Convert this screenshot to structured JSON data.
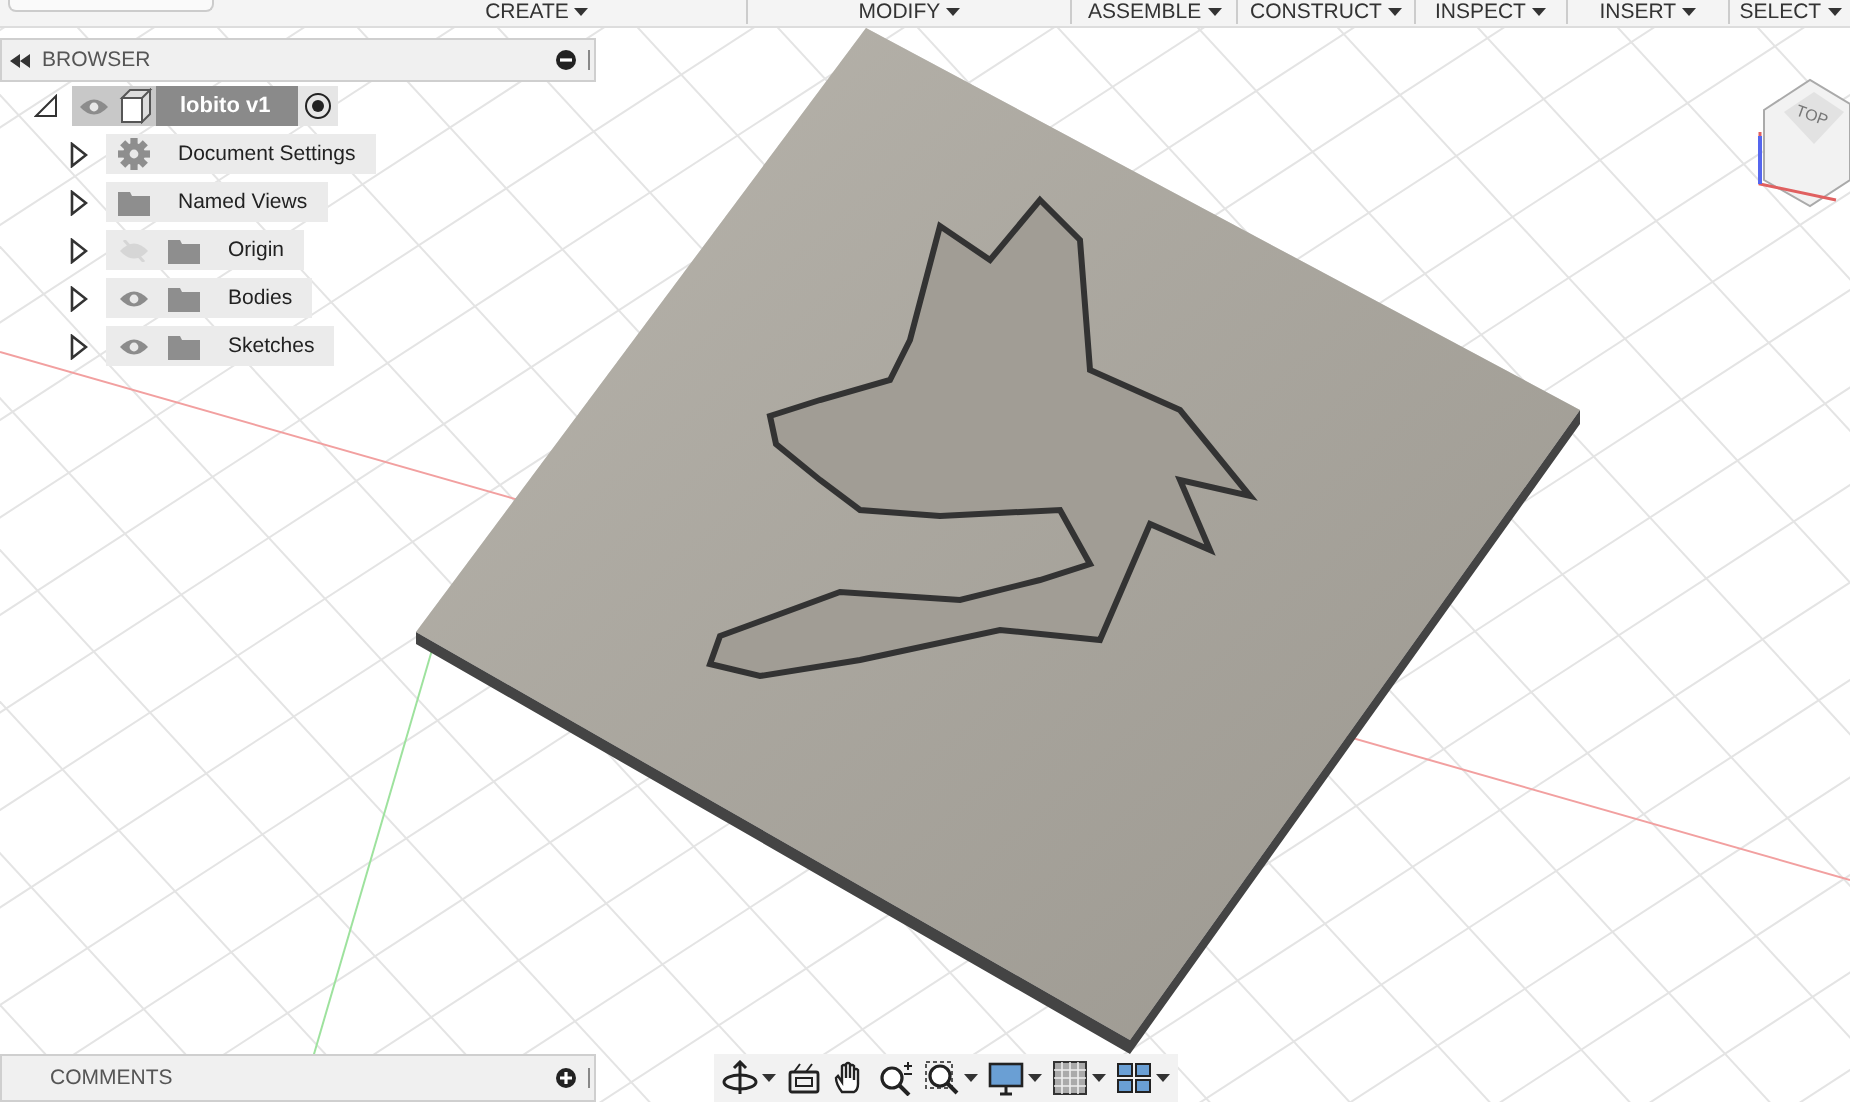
{
  "toolbar": {
    "menus": [
      {
        "label": "CREATE"
      },
      {
        "label": "MODIFY"
      },
      {
        "label": "ASSEMBLE"
      },
      {
        "label": "CONSTRUCT"
      },
      {
        "label": "INSPECT"
      },
      {
        "label": "INSERT"
      },
      {
        "label": "SELECT"
      }
    ]
  },
  "browser": {
    "title": "BROWSER",
    "root": {
      "label": "lobito v1",
      "expanded": true,
      "visible": true,
      "children": [
        {
          "label": "Document Settings",
          "kind": "settings",
          "expanded": false
        },
        {
          "label": "Named Views",
          "kind": "folder",
          "expanded": false
        },
        {
          "label": "Origin",
          "kind": "folder",
          "visible": false,
          "expanded": false
        },
        {
          "label": "Bodies",
          "kind": "folder",
          "visible": true,
          "expanded": false
        },
        {
          "label": "Sketches",
          "kind": "folder",
          "visible": true,
          "expanded": false
        }
      ]
    }
  },
  "view_cube": {
    "face": "TOP"
  },
  "comments": {
    "title": "COMMENTS"
  },
  "navigation_bar": {
    "tools": [
      {
        "kind": "orbit",
        "menu": true
      },
      {
        "kind": "look",
        "menu": false
      },
      {
        "kind": "pan",
        "menu": false
      },
      {
        "kind": "zoom",
        "menu": false
      },
      {
        "kind": "fit",
        "menu": true
      },
      {
        "kind": "display",
        "menu": true
      },
      {
        "kind": "grid",
        "menu": true
      },
      {
        "kind": "viewports",
        "menu": true
      }
    ]
  }
}
